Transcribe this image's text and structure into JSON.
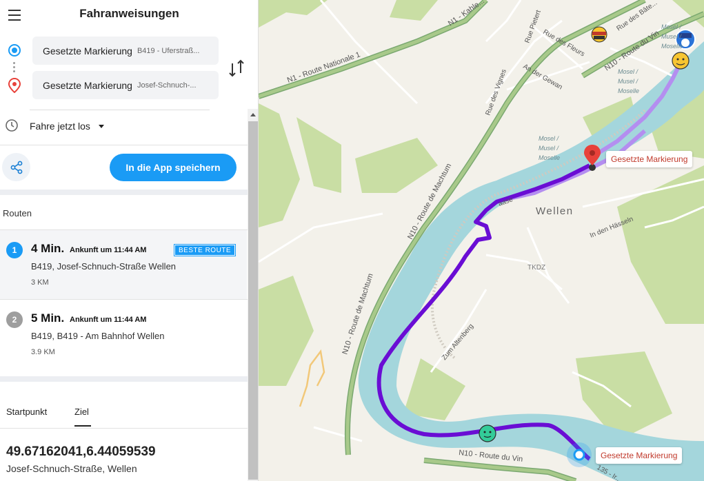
{
  "header": {
    "title": "Fahranweisungen"
  },
  "origin": {
    "main": "Gesetzte Markierung",
    "sub": "B419 - Uferstraß..."
  },
  "destination": {
    "main": "Gesetzte Markierung",
    "sub": "Josef-Schnuch-..."
  },
  "depart": {
    "label": "Fahre jetzt los"
  },
  "save_button": "In die App speichern",
  "routes_header": "Routen",
  "routes": [
    {
      "num": "1",
      "duration": "4 Min.",
      "arrival": "Ankunft um 11:44 AM",
      "badge": "BESTE ROUTE",
      "via": "B419, Josef-Schnuch-Straße Wellen",
      "distance": "3 KM"
    },
    {
      "num": "2",
      "duration": "5 Min.",
      "arrival": "Ankunft um 11:44 AM",
      "via": "B419, B419 - Am Bahnhof Wellen",
      "distance": "3.9 KM"
    }
  ],
  "tabs": {
    "start": "Startpunkt",
    "goal": "Ziel"
  },
  "details": {
    "coords": "49.67162041,6.44059539",
    "address": "Josef-Schnuch-Straße, Wellen"
  },
  "map": {
    "town": "Wellen",
    "tkdz": "TKDZ",
    "streets": {
      "n1": "N1 - Route Nationale 1",
      "n1_top": "N1 - Kahle...",
      "n10_west": "N10 - Route de Machtum",
      "n10_west2": "N10 - Route de Machtum",
      "n10_north": "N10 - Route du Vin",
      "n10_south": "N10 - Route du Vin",
      "rue_vignes": "Rue des Vignes",
      "rue_fleurs": "Rue des Fleurs",
      "rue_pietert": "Rue Pietert",
      "an_der_gewan": "An der Gewan",
      "rue_bateliers": "Rue des Bâte...",
      "in_den_hasseln": "In den Hässeln",
      "zum_altenberg": "Zum Altenberg",
      "aase": "aase",
      "b135": "135 - Ir..."
    },
    "river": {
      "l1": "Mosel /",
      "l2": "Musel /",
      "l3": "Moselle"
    },
    "marker_top": "Gesetzte Markierung",
    "marker_bottom": "Gesetzte Markierung",
    "colors": {
      "route": "#6a0dd4",
      "alt_route": "#b48ef0",
      "river": "#a4d6dc",
      "accent": "#1a9bf5",
      "pin": "#e8413a"
    }
  }
}
